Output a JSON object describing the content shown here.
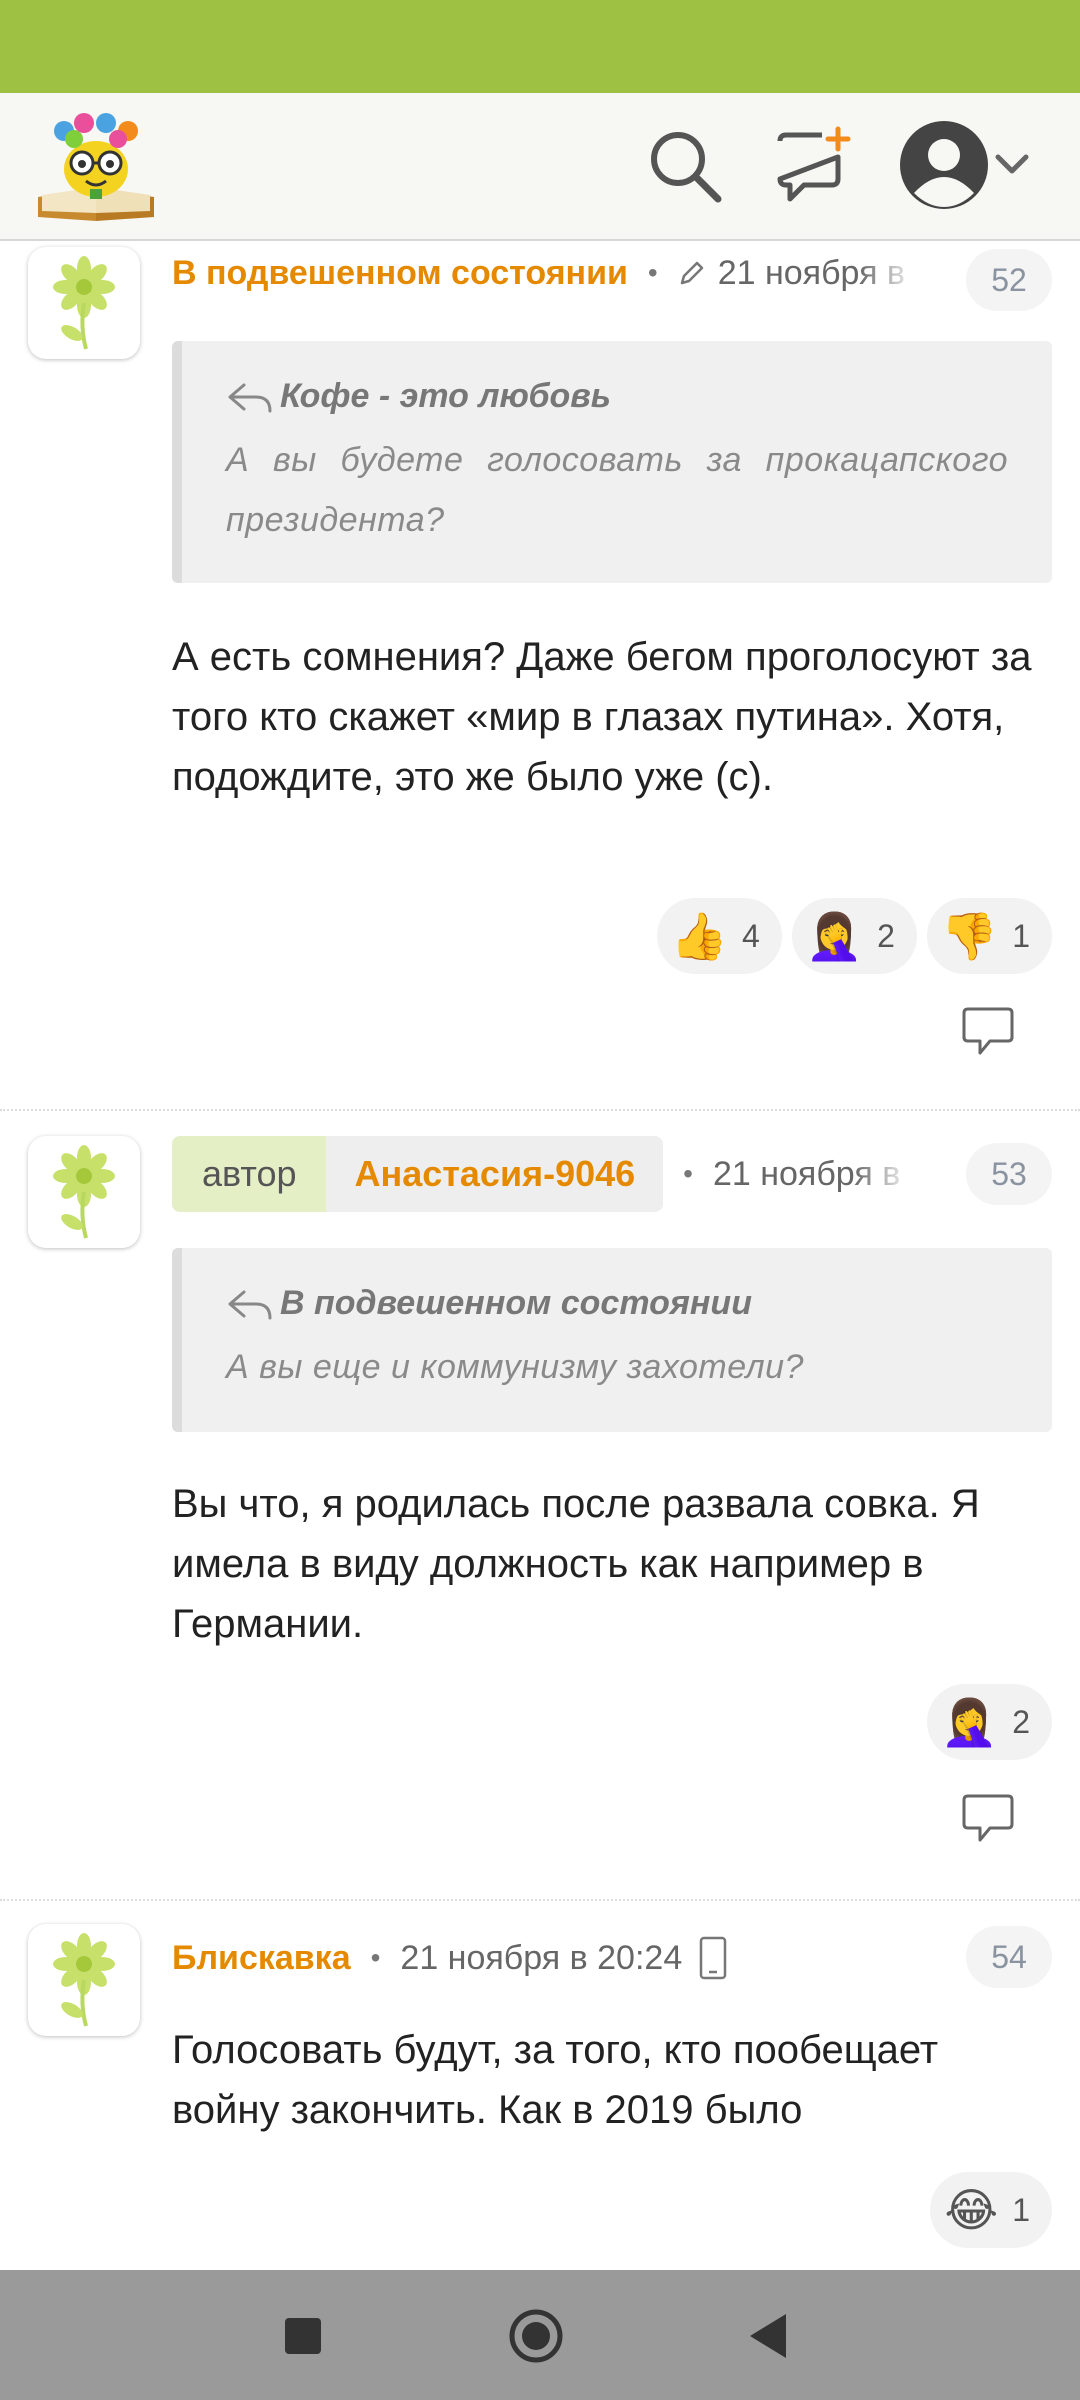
{
  "header": {
    "icons": [
      "logo-flower-book",
      "search-icon",
      "new-post-icon",
      "avatar-icon",
      "chevron-down-icon"
    ]
  },
  "comments": [
    {
      "author": "В подвешенном состоянии",
      "edited": true,
      "date": "21 ноября в",
      "number": "52",
      "quote": {
        "author": "Кофе - это любовь",
        "text": "А вы будете голосовать за прокацапского президента?"
      },
      "text": "А есть сомнения? Даже бегом проголосуют за того кто скажет «мир в глазах путина». Хотя, подождите, это же было уже (с).",
      "reactions": [
        {
          "emoji": "👍",
          "count": "4"
        },
        {
          "emoji": "🤦‍♀️",
          "count": "2"
        },
        {
          "emoji": "👎",
          "count": "1"
        }
      ]
    },
    {
      "author_tag": "автор",
      "author": "Анастасия-9046",
      "date": "21 ноября в",
      "number": "53",
      "quote": {
        "author": "В подвешенном состоянии",
        "text": "А вы еще и коммунизму захотели?"
      },
      "text": "Вы что, я родилась после развала совка. Я имела в виду должность как например в Германии.",
      "reactions": [
        {
          "emoji": "🤦‍♀️",
          "count": "2"
        }
      ]
    },
    {
      "author": "Блискавка",
      "date": "21 ноября в 20:24",
      "device": "phone-icon",
      "number": "54",
      "text": "Голосовать будут, за того, кто пообещает войну закончить. Как в 2019 было",
      "reactions": [
        {
          "emoji": "😂",
          "count": "1"
        }
      ]
    }
  ],
  "colors": {
    "status_bar": "#9fc143",
    "accent": "#e58a00",
    "author_tag_bg": "#e5efc6"
  }
}
